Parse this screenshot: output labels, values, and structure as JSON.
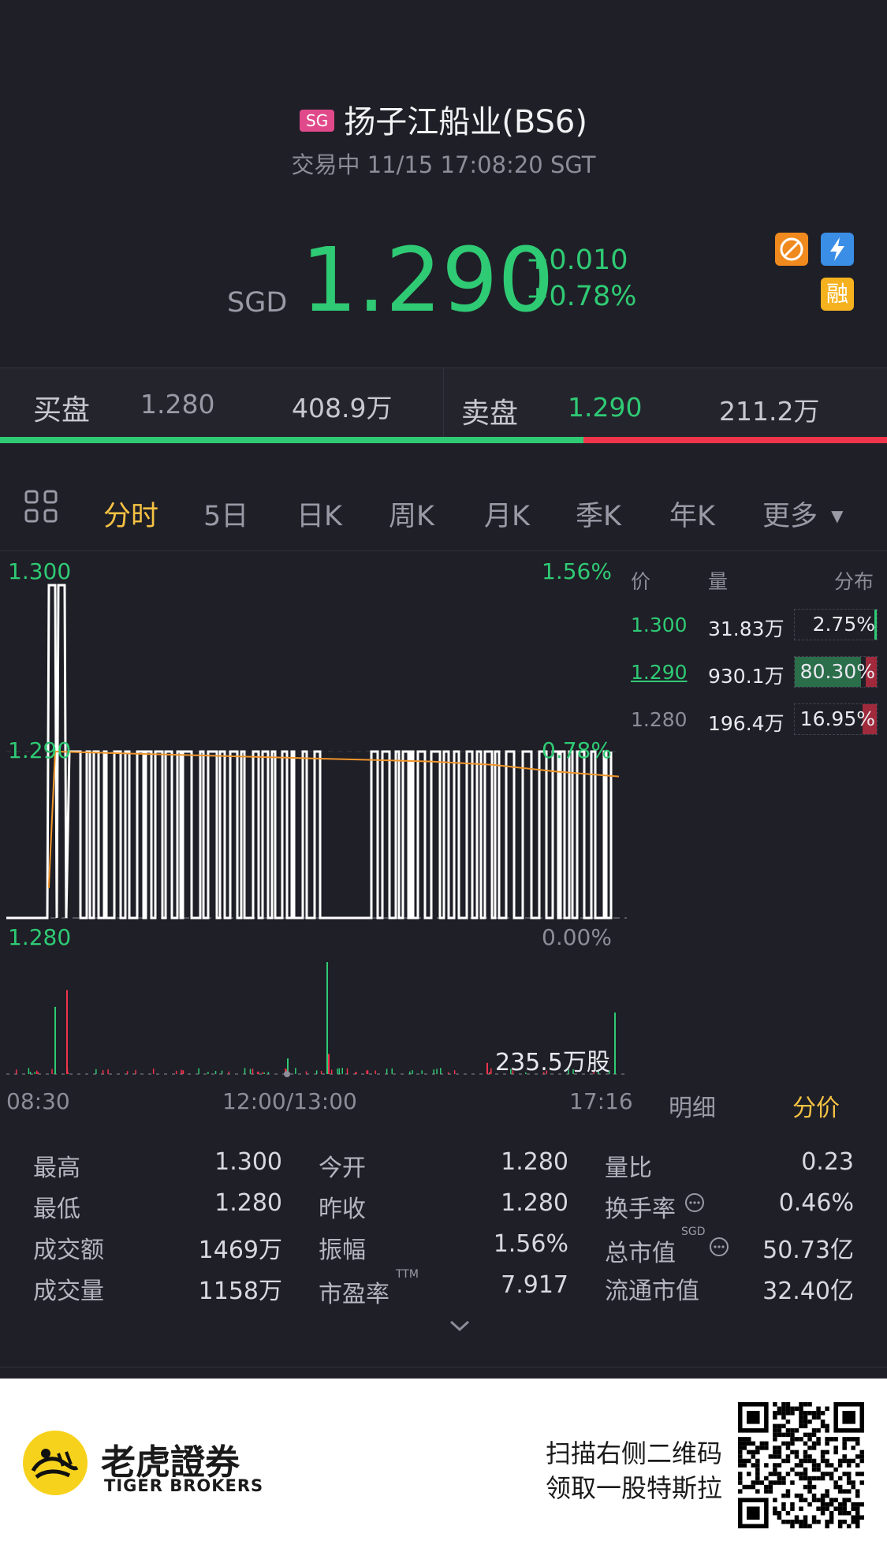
{
  "header": {
    "market_badge": "SG",
    "title": "扬子江船业(BS6)",
    "status": "交易中 11/15 17:08:20 SGT"
  },
  "quote": {
    "currency": "SGD",
    "price": "1.290",
    "change": "+0.010",
    "change_pct": "+0.78%",
    "flag_icons": [
      "no-shorting-icon",
      "lightning-icon",
      "margin-icon"
    ],
    "margin_label": "融"
  },
  "order_book": {
    "bid_label": "买盘",
    "bid_price": "1.280",
    "bid_volume": "408.9万",
    "ask_label": "卖盘",
    "ask_price": "1.290",
    "ask_volume": "211.2万",
    "bid_ratio": 0.658
  },
  "tabs": [
    {
      "label": "分时",
      "active": true
    },
    {
      "label": "5日"
    },
    {
      "label": "日K"
    },
    {
      "label": "周K"
    },
    {
      "label": "月K"
    },
    {
      "label": "季K"
    },
    {
      "label": "年K"
    },
    {
      "label": "更多"
    }
  ],
  "chart": {
    "y_labels": [
      "1.300",
      "1.290",
      "1.280"
    ],
    "pct_labels": [
      "1.56%",
      "0.78%",
      "0.00%"
    ],
    "volume_label": "235.5万股",
    "time_labels": [
      "08:30",
      "12:00/13:00",
      "17:16"
    ]
  },
  "chart_data": {
    "type": "line",
    "title": "",
    "ylim": [
      1.28,
      1.3
    ],
    "x_range": [
      "08:30",
      "17:16"
    ],
    "series": [
      {
        "name": "",
        "color": "#ffffff",
        "values": [
          1.28,
          1.28,
          1.3,
          1.3,
          1.28,
          1.29,
          1.29,
          1.28,
          1.29,
          1.28,
          1.29,
          1.28,
          1.29,
          1.28,
          1.29
        ]
      },
      {
        "name": "",
        "color": "#f0962b",
        "values": [
          1.282,
          1.29,
          1.2899,
          1.2898,
          1.2897,
          1.2896,
          1.2895,
          1.2894,
          1.2892,
          1.2888,
          1.2885
        ]
      }
    ]
  },
  "distribution": {
    "headers": [
      "价",
      "量",
      "分布"
    ],
    "rows": [
      {
        "price": "1.300",
        "volume": "31.83万",
        "pct": "2.75%",
        "ratio": 0.0275
      },
      {
        "price": "1.290",
        "volume": "930.1万",
        "pct": "80.30%",
        "ratio": 0.803
      },
      {
        "price": "1.280",
        "volume": "196.4万",
        "pct": "16.95%",
        "ratio": 0.1695
      }
    ],
    "tab_detail": "明细",
    "tab_price": "分价"
  },
  "stats": [
    [
      {
        "k": "最高",
        "v": "1.300"
      },
      {
        "k": "今开",
        "v": "1.280"
      },
      {
        "k": "量比",
        "v": "0.23"
      }
    ],
    [
      {
        "k": "最低",
        "v": "1.280"
      },
      {
        "k": "昨收",
        "v": "1.280"
      },
      {
        "k": "换手率",
        "v": "0.46%"
      }
    ],
    [
      {
        "k": "成交额",
        "v": "1469万"
      },
      {
        "k": "振幅",
        "v": "1.56%"
      },
      {
        "k": "总市值",
        "v": "50.73亿"
      }
    ],
    [
      {
        "k": "成交量",
        "v": "1158万"
      },
      {
        "k": "市盈率",
        "v": "7.917"
      },
      {
        "k": "流通市值",
        "v": "32.40亿"
      }
    ]
  ],
  "stat_sup": {
    "ttm": "TTM",
    "sgd": "SGD"
  },
  "footer": {
    "brand_cn": "老虎證券",
    "brand_en": "TIGER BROKERS",
    "promo_line1": "扫描右侧二维码",
    "promo_line2": "领取一股特斯拉"
  },
  "colors": {
    "up": "#2fca74",
    "down": "#f0344c",
    "accent": "#f5c243",
    "avg_line": "#f0962b"
  }
}
